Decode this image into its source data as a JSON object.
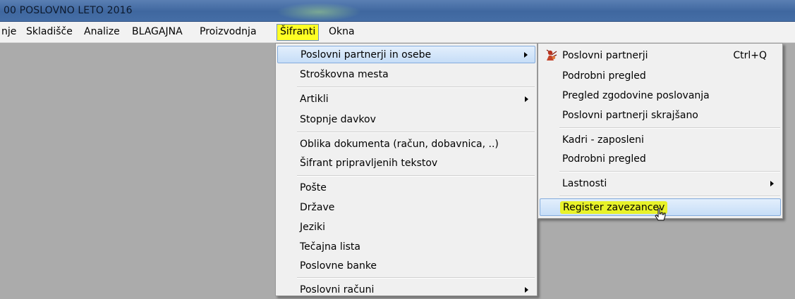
{
  "window": {
    "title": "00 POSLOVNO LETO 2016"
  },
  "menubar": {
    "items": [
      "nje",
      "Skladišče",
      "Analize",
      "BLAGAJNA",
      "Proizvodnja",
      "Šifranti",
      "Okna"
    ]
  },
  "sifranti_menu": {
    "items": [
      {
        "label": "Poslovni partnerji in osebe",
        "submenu": true
      },
      {
        "label": "Stroškovna mesta"
      },
      {
        "label": "Artikli",
        "submenu": true
      },
      {
        "label": "Stopnje davkov"
      },
      {
        "label": "Oblika dokumenta (račun, dobavnica, ..)"
      },
      {
        "label": "Šifrant pripravljenih tekstov"
      },
      {
        "label": "Pošte"
      },
      {
        "label": "Države"
      },
      {
        "label": "Jeziki"
      },
      {
        "label": "Tečajna lista"
      },
      {
        "label": "Poslovne banke"
      },
      {
        "label": "Poslovni računi",
        "submenu": true
      }
    ]
  },
  "partnerji_submenu": {
    "items": [
      {
        "label": "Poslovni partnerji",
        "shortcut": "Ctrl+Q",
        "icon": "partner-icon"
      },
      {
        "label": "Podrobni pregled"
      },
      {
        "label": "Pregled zgodovine poslovanja"
      },
      {
        "label": "Poslovni partnerji skrajšano"
      },
      {
        "label": "Kadri - zaposleni"
      },
      {
        "label": "Podrobni pregled"
      },
      {
        "label": "Lastnosti",
        "submenu": true
      },
      {
        "label": "Register zavezancev"
      }
    ]
  },
  "colors": {
    "desktop": "#ababab",
    "menu_highlight": "#ffff24",
    "item_hover": "#c6ddf7",
    "marker_highlight": "#e8f22a"
  }
}
